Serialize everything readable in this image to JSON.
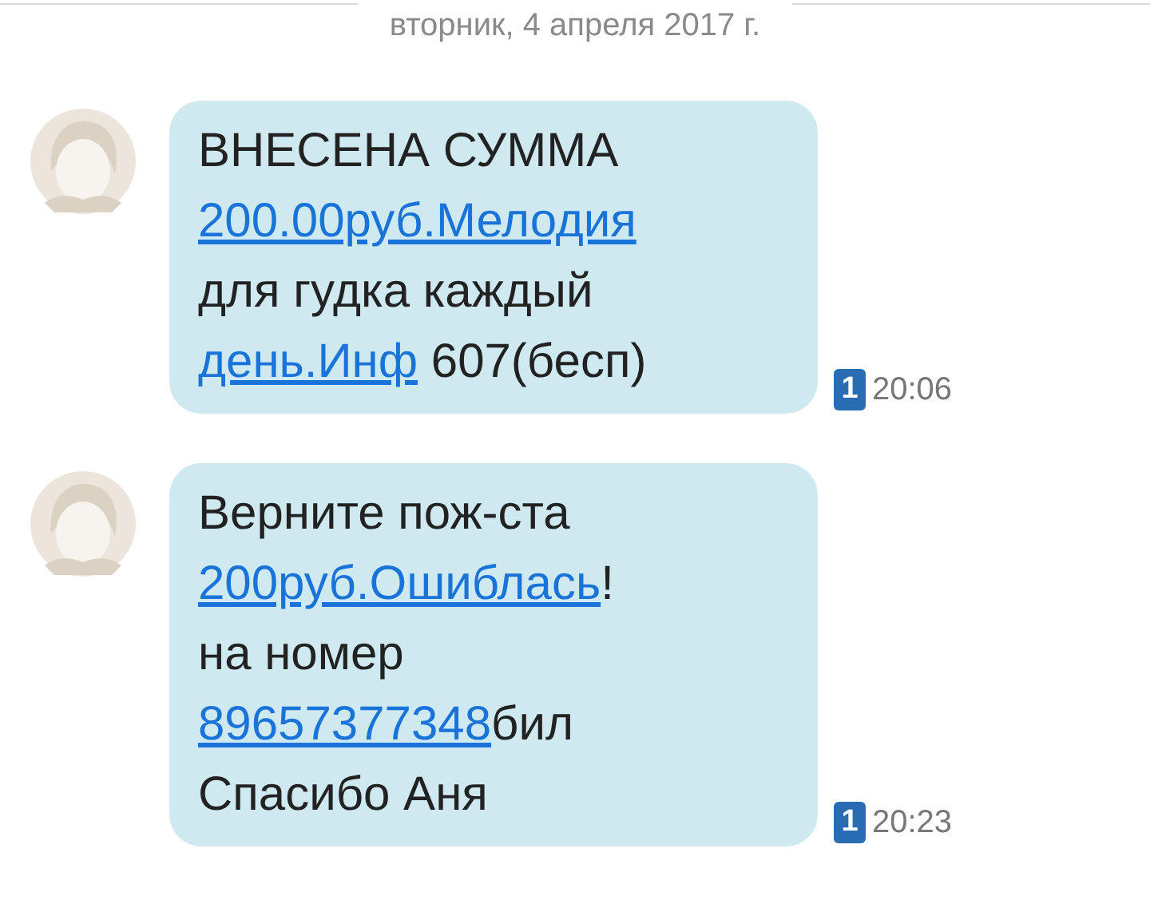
{
  "date_header": "вторник, 4 апреля 2017 г.",
  "messages": [
    {
      "lines": [
        [
          {
            "text": "ВНЕСЕНА СУММА",
            "kind": "text"
          }
        ],
        [
          {
            "text": "200.00руб.Мелодия",
            "kind": "link"
          }
        ],
        [
          {
            "text": "для гудка каждый",
            "kind": "text"
          }
        ],
        [
          {
            "text": "день.Инф",
            "kind": "link"
          },
          {
            "text": " 607(бесп)",
            "kind": "text"
          }
        ]
      ],
      "sim": "1",
      "time": "20:06"
    },
    {
      "lines": [
        [
          {
            "text": "Верните пож-ста",
            "kind": "text"
          }
        ],
        [
          {
            "text": "200руб.Ошиблась",
            "kind": "link"
          },
          {
            "text": "!",
            "kind": "text"
          }
        ],
        [
          {
            "text": "на номер",
            "kind": "text"
          }
        ],
        [
          {
            "text": "89657377348",
            "kind": "link"
          },
          {
            "text": "бил",
            "kind": "text"
          }
        ],
        [
          {
            "text": "Спасибо Аня",
            "kind": "text"
          }
        ]
      ],
      "sim": "1",
      "time": "20:23"
    }
  ]
}
